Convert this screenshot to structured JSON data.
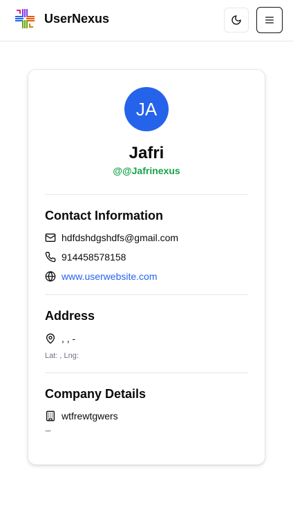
{
  "header": {
    "brand_name": "UserNexus",
    "logo_icon": "usernexus-logo",
    "theme_icon": "moon-icon",
    "menu_icon": "hamburger-menu-icon"
  },
  "profile": {
    "avatar_initials": "JA",
    "avatar_color": "#2563eb",
    "name": "Jafri",
    "username": "@@Jafrinexus",
    "username_color": "#16a34a"
  },
  "contact": {
    "title": "Contact Information",
    "email": "hdfdshdgshdfs@gmail.com",
    "phone": "914458578158",
    "website": "www.userwebsite.com",
    "link_color": "#2563eb"
  },
  "address": {
    "title": "Address",
    "line": ", , -",
    "geo": "Lat: , Lng:"
  },
  "company": {
    "title": "Company Details",
    "name": "wtfrewtgwers",
    "catchphrase": "\"\""
  }
}
